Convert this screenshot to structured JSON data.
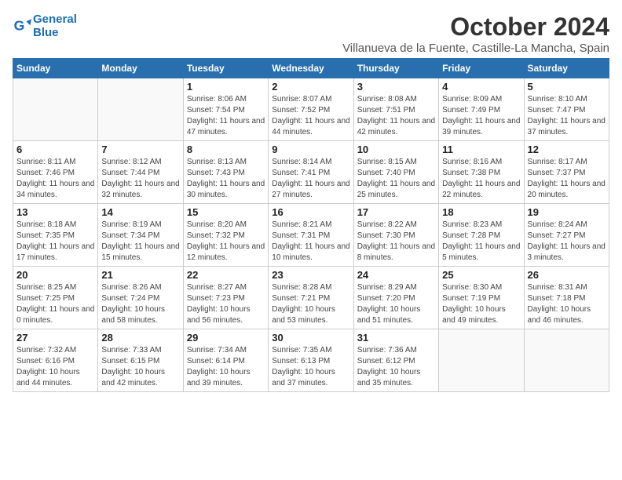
{
  "logo": {
    "line1": "General",
    "line2": "Blue"
  },
  "title": "October 2024",
  "subtitle": "Villanueva de la Fuente, Castille-La Mancha, Spain",
  "days_of_week": [
    "Sunday",
    "Monday",
    "Tuesday",
    "Wednesday",
    "Thursday",
    "Friday",
    "Saturday"
  ],
  "weeks": [
    [
      {
        "day": "",
        "info": ""
      },
      {
        "day": "",
        "info": ""
      },
      {
        "day": "1",
        "info": "Sunrise: 8:06 AM\nSunset: 7:54 PM\nDaylight: 11 hours and 47 minutes."
      },
      {
        "day": "2",
        "info": "Sunrise: 8:07 AM\nSunset: 7:52 PM\nDaylight: 11 hours and 44 minutes."
      },
      {
        "day": "3",
        "info": "Sunrise: 8:08 AM\nSunset: 7:51 PM\nDaylight: 11 hours and 42 minutes."
      },
      {
        "day": "4",
        "info": "Sunrise: 8:09 AM\nSunset: 7:49 PM\nDaylight: 11 hours and 39 minutes."
      },
      {
        "day": "5",
        "info": "Sunrise: 8:10 AM\nSunset: 7:47 PM\nDaylight: 11 hours and 37 minutes."
      }
    ],
    [
      {
        "day": "6",
        "info": "Sunrise: 8:11 AM\nSunset: 7:46 PM\nDaylight: 11 hours and 34 minutes."
      },
      {
        "day": "7",
        "info": "Sunrise: 8:12 AM\nSunset: 7:44 PM\nDaylight: 11 hours and 32 minutes."
      },
      {
        "day": "8",
        "info": "Sunrise: 8:13 AM\nSunset: 7:43 PM\nDaylight: 11 hours and 30 minutes."
      },
      {
        "day": "9",
        "info": "Sunrise: 8:14 AM\nSunset: 7:41 PM\nDaylight: 11 hours and 27 minutes."
      },
      {
        "day": "10",
        "info": "Sunrise: 8:15 AM\nSunset: 7:40 PM\nDaylight: 11 hours and 25 minutes."
      },
      {
        "day": "11",
        "info": "Sunrise: 8:16 AM\nSunset: 7:38 PM\nDaylight: 11 hours and 22 minutes."
      },
      {
        "day": "12",
        "info": "Sunrise: 8:17 AM\nSunset: 7:37 PM\nDaylight: 11 hours and 20 minutes."
      }
    ],
    [
      {
        "day": "13",
        "info": "Sunrise: 8:18 AM\nSunset: 7:35 PM\nDaylight: 11 hours and 17 minutes."
      },
      {
        "day": "14",
        "info": "Sunrise: 8:19 AM\nSunset: 7:34 PM\nDaylight: 11 hours and 15 minutes."
      },
      {
        "day": "15",
        "info": "Sunrise: 8:20 AM\nSunset: 7:32 PM\nDaylight: 11 hours and 12 minutes."
      },
      {
        "day": "16",
        "info": "Sunrise: 8:21 AM\nSunset: 7:31 PM\nDaylight: 11 hours and 10 minutes."
      },
      {
        "day": "17",
        "info": "Sunrise: 8:22 AM\nSunset: 7:30 PM\nDaylight: 11 hours and 8 minutes."
      },
      {
        "day": "18",
        "info": "Sunrise: 8:23 AM\nSunset: 7:28 PM\nDaylight: 11 hours and 5 minutes."
      },
      {
        "day": "19",
        "info": "Sunrise: 8:24 AM\nSunset: 7:27 PM\nDaylight: 11 hours and 3 minutes."
      }
    ],
    [
      {
        "day": "20",
        "info": "Sunrise: 8:25 AM\nSunset: 7:25 PM\nDaylight: 11 hours and 0 minutes."
      },
      {
        "day": "21",
        "info": "Sunrise: 8:26 AM\nSunset: 7:24 PM\nDaylight: 10 hours and 58 minutes."
      },
      {
        "day": "22",
        "info": "Sunrise: 8:27 AM\nSunset: 7:23 PM\nDaylight: 10 hours and 56 minutes."
      },
      {
        "day": "23",
        "info": "Sunrise: 8:28 AM\nSunset: 7:21 PM\nDaylight: 10 hours and 53 minutes."
      },
      {
        "day": "24",
        "info": "Sunrise: 8:29 AM\nSunset: 7:20 PM\nDaylight: 10 hours and 51 minutes."
      },
      {
        "day": "25",
        "info": "Sunrise: 8:30 AM\nSunset: 7:19 PM\nDaylight: 10 hours and 49 minutes."
      },
      {
        "day": "26",
        "info": "Sunrise: 8:31 AM\nSunset: 7:18 PM\nDaylight: 10 hours and 46 minutes."
      }
    ],
    [
      {
        "day": "27",
        "info": "Sunrise: 7:32 AM\nSunset: 6:16 PM\nDaylight: 10 hours and 44 minutes."
      },
      {
        "day": "28",
        "info": "Sunrise: 7:33 AM\nSunset: 6:15 PM\nDaylight: 10 hours and 42 minutes."
      },
      {
        "day": "29",
        "info": "Sunrise: 7:34 AM\nSunset: 6:14 PM\nDaylight: 10 hours and 39 minutes."
      },
      {
        "day": "30",
        "info": "Sunrise: 7:35 AM\nSunset: 6:13 PM\nDaylight: 10 hours and 37 minutes."
      },
      {
        "day": "31",
        "info": "Sunrise: 7:36 AM\nSunset: 6:12 PM\nDaylight: 10 hours and 35 minutes."
      },
      {
        "day": "",
        "info": ""
      },
      {
        "day": "",
        "info": ""
      }
    ]
  ]
}
